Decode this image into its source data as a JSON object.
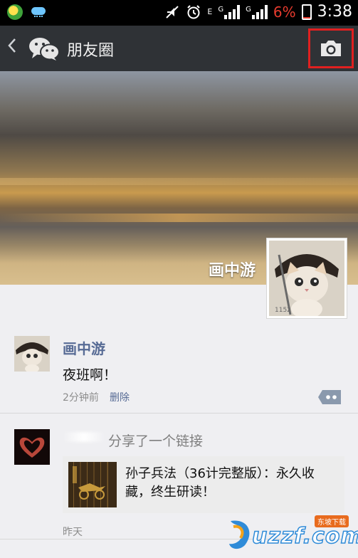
{
  "status_bar": {
    "network_1": "E",
    "network_2": "G",
    "network_3": "G",
    "battery_percent": "6%",
    "time": "3:38"
  },
  "header": {
    "back_icon": "chevron-left-icon",
    "logo_icon": "wechat-logo-icon",
    "title": "朋友圈",
    "camera_icon": "camera-icon"
  },
  "cover": {
    "name": "画中游",
    "avatar_caption": "1152"
  },
  "posts": [
    {
      "name": "画中游",
      "text": "夜班啊！",
      "time": "2分钟前",
      "delete_label": "删除"
    },
    {
      "share_label": "分享了一个链接",
      "link_title": "孙子兵法（36计完整版）：永久收藏，终生研读！",
      "time": "昨天"
    }
  ],
  "watermark": {
    "text": "uzzf.com",
    "tag": "东坡下载"
  },
  "colors": {
    "accent_name": "#576b95",
    "header_bg": "#2f3236",
    "highlight_box": "#e02020"
  }
}
